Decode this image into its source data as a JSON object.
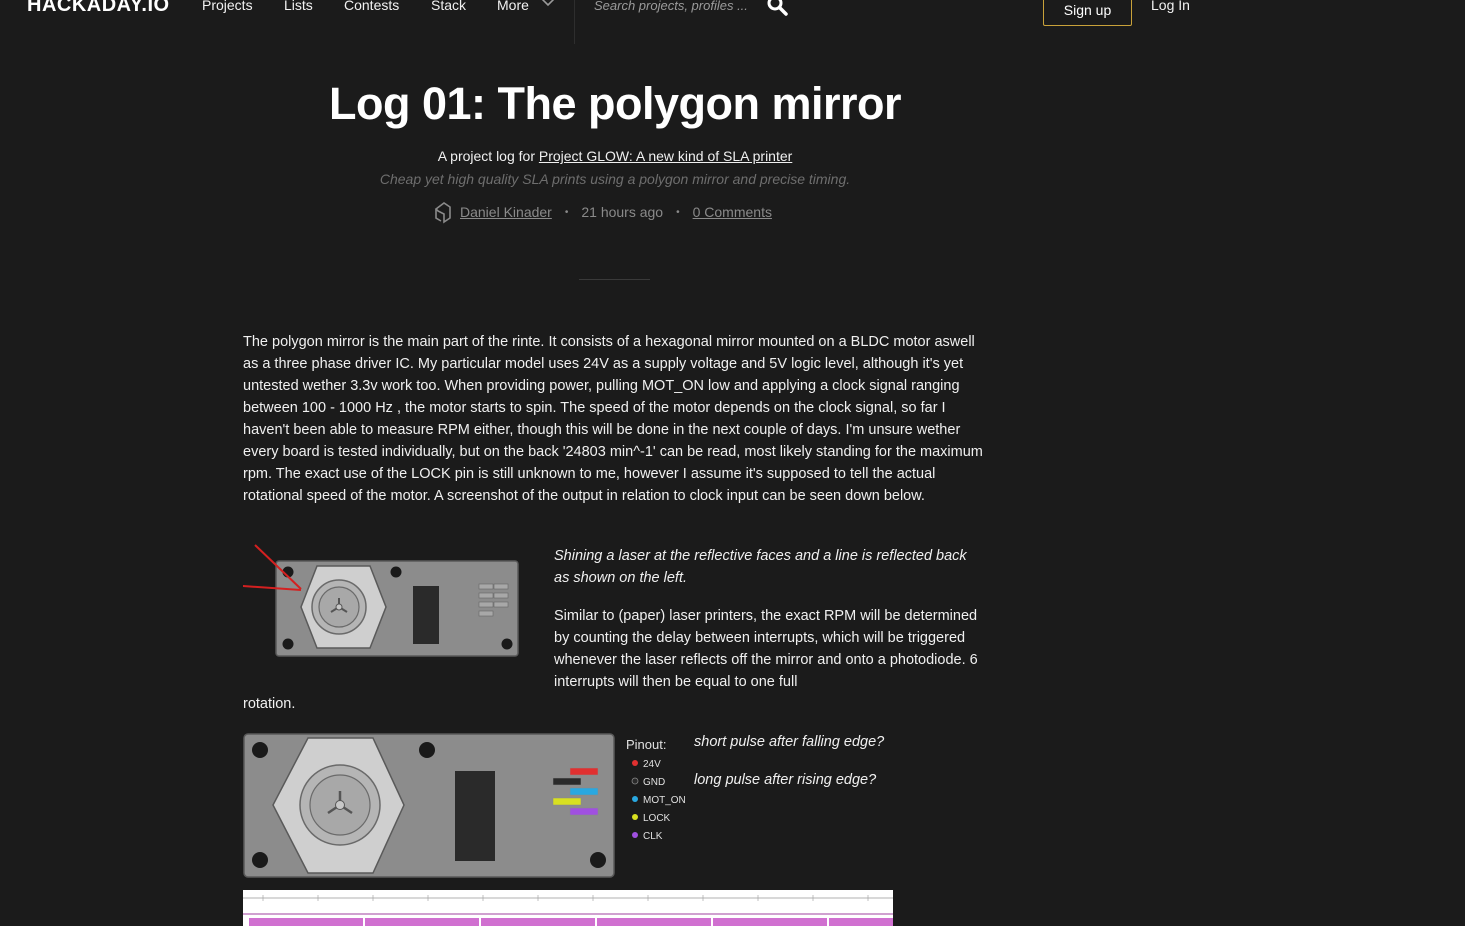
{
  "nav": {
    "logo": "HACKADAY.IO",
    "links": [
      "Projects",
      "Lists",
      "Contests",
      "Stack",
      "More"
    ],
    "search_placeholder": "Search projects, profiles ...",
    "signup": "Sign up",
    "login": "Log In"
  },
  "header": {
    "title": "Log 01: The polygon mirror",
    "project_prefix": "A project log for ",
    "project_link": "Project GLOW: A new kind of SLA printer",
    "tagline": "Cheap yet high quality SLA prints using a polygon mirror and precise timing.",
    "author": "Daniel Kinader",
    "time": "21 hours ago",
    "comments": "0 Comments",
    "bullet": "•"
  },
  "body": {
    "para1": "The polygon mirror is the main part of the rinte. It consists of a hexagonal mirror mounted on a BLDC motor aswell as a three phase driver IC. My particular model uses 24V as a supply voltage and 5V logic level, although it's yet untested wether 3.3v work too. When providing power, pulling MOT_ON low and applying a clock signal ranging between 100 - 1000 Hz , the motor starts to spin. The speed of the motor depends on the clock signal, so far I haven't been able to measure RPM either, though this will be done in the next couple of days. I'm unsure wether every board is tested individually, but on the back '24803 min^-1' can be read, most likely standing for the maximum rpm. The exact use of the LOCK pin is still unknown to me, however I assume it's supposed to tell the actual rotational speed of the motor. A screenshot of the output in relation to clock input can be seen down below.",
    "caption": "Shining a laser at the reflective faces and a line is reflected back as shown on the left.",
    "para2": "Similar to (paper) laser printers, the exact RPM will be determined by counting the delay between interrupts, which will be triggered whenever the laser reflects off the mirror and onto a photodiode. 6 interrupts will then be equal to one full",
    "para2_tail": "rotation.",
    "q1": "short pulse after falling edge?",
    "q2": "long pulse after rising edge?"
  },
  "pinout": {
    "title": "Pinout:",
    "pins": [
      {
        "label": "24V",
        "color": "#e03030"
      },
      {
        "label": "GND",
        "color": "#2a2a2a"
      },
      {
        "label": "MOT_ON",
        "color": "#29a8e0"
      },
      {
        "label": "LOCK",
        "color": "#d8e020"
      },
      {
        "label": "CLK",
        "color": "#a050e0"
      }
    ]
  },
  "colors": {
    "background": "#1b1b1b",
    "accent_border": "#c9a23a",
    "board_gray": "#8c8c8c",
    "annotation_red": "#d42020",
    "scope_pink": "#d070d0"
  }
}
